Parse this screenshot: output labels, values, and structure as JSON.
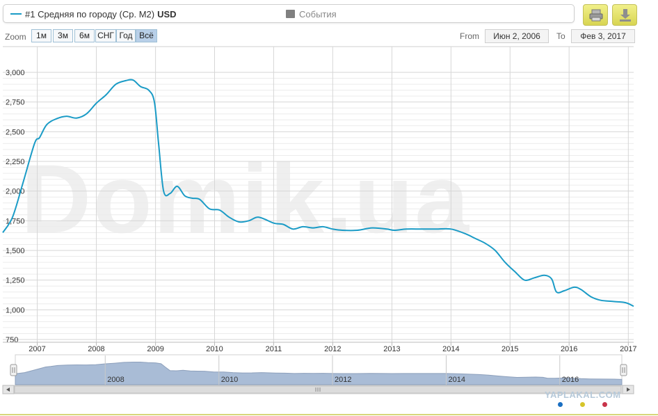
{
  "legend": {
    "series_label": "#1 Средняя по городу (Ср. М2)",
    "series_unit": "USD",
    "events_label": "События"
  },
  "range_selector": {
    "zoom_label": "Zoom",
    "buttons": [
      "1м",
      "3м",
      "6м",
      "СНГ",
      "Год",
      "Всё"
    ],
    "active_button": "Всё",
    "from_label": "From",
    "from_value": "Июн 2, 2006",
    "to_label": "To",
    "to_value": "Фев 3, 2017"
  },
  "icons": {
    "print": "printer-icon",
    "download": "download-icon"
  },
  "watermark": "Domik.ua",
  "site_mark": "YAPLAKAL.COM",
  "colors": {
    "series": "#1a9bc6",
    "navigator_fill": "#a9bcd6",
    "navigator_line": "#8c9fbb",
    "button_accent": "#e3e06a",
    "dot_blue": "#1a6fc2",
    "dot_yellow": "#d6c52a",
    "dot_red": "#c8344a"
  },
  "chart_data": {
    "type": "line",
    "title": "",
    "xlabel": "",
    "ylabel": "",
    "series": [
      {
        "name": "#1 Средняя по городу (Ср. М2)",
        "unit": "USD",
        "x": [
          "2006-06-02",
          "2006-08-01",
          "2006-10-01",
          "2006-12-15",
          "2007-01-15",
          "2007-03-01",
          "2007-05-01",
          "2007-07-01",
          "2007-09-01",
          "2007-11-01",
          "2008-01-01",
          "2008-03-01",
          "2008-05-01",
          "2008-07-01",
          "2008-08-15",
          "2008-10-01",
          "2008-11-20",
          "2008-12-25",
          "2009-01-20",
          "2009-02-20",
          "2009-04-01",
          "2009-05-15",
          "2009-07-01",
          "2009-08-15",
          "2009-10-01",
          "2009-12-01",
          "2010-02-01",
          "2010-04-01",
          "2010-06-01",
          "2010-08-01",
          "2010-10-01",
          "2011-01-01",
          "2011-03-01",
          "2011-05-01",
          "2011-07-01",
          "2011-09-01",
          "2011-11-01",
          "2012-01-01",
          "2012-03-01",
          "2012-06-01",
          "2012-09-01",
          "2012-12-01",
          "2013-01-15",
          "2013-04-01",
          "2013-07-01",
          "2013-10-01",
          "2014-01-01",
          "2014-04-01",
          "2014-06-01",
          "2014-08-01",
          "2014-10-01",
          "2014-12-01",
          "2015-02-01",
          "2015-04-01",
          "2015-06-01",
          "2015-08-01",
          "2015-09-15",
          "2015-10-15",
          "2015-12-01",
          "2016-02-01",
          "2016-03-15",
          "2016-05-15",
          "2016-07-15",
          "2016-10-01",
          "2016-12-15",
          "2017-02-03"
        ],
        "y": [
          1650,
          1780,
          2050,
          2400,
          2450,
          2560,
          2610,
          2630,
          2615,
          2650,
          2740,
          2810,
          2900,
          2930,
          2935,
          2880,
          2850,
          2750,
          2400,
          2000,
          1980,
          2040,
          1960,
          1940,
          1930,
          1850,
          1840,
          1780,
          1740,
          1750,
          1780,
          1730,
          1720,
          1680,
          1700,
          1690,
          1700,
          1680,
          1670,
          1670,
          1690,
          1680,
          1670,
          1680,
          1680,
          1680,
          1680,
          1640,
          1600,
          1560,
          1500,
          1400,
          1320,
          1250,
          1270,
          1290,
          1260,
          1150,
          1160,
          1190,
          1170,
          1110,
          1080,
          1070,
          1060,
          1030
        ]
      }
    ],
    "y_ticks": [
      750,
      1000,
      1250,
      1500,
      1750,
      2000,
      2250,
      2500,
      2750,
      3000
    ],
    "y_tick_labels": [
      "750",
      "1,000",
      "1,250",
      "1,500",
      "1,750",
      "2,000",
      "2,250",
      "2,500",
      "2,750",
      "3,000"
    ],
    "ylim": [
      750,
      3000
    ],
    "x_ticks": [
      "2007",
      "2008",
      "2009",
      "2010",
      "2011",
      "2012",
      "2013",
      "2014",
      "2015",
      "2016",
      "2017"
    ],
    "xlim": [
      "2006-06-02",
      "2017-02-03"
    ],
    "navigator_ticks": [
      "2008",
      "2010",
      "2012",
      "2014",
      "2016"
    ],
    "grid": true,
    "legend_position": "top"
  }
}
